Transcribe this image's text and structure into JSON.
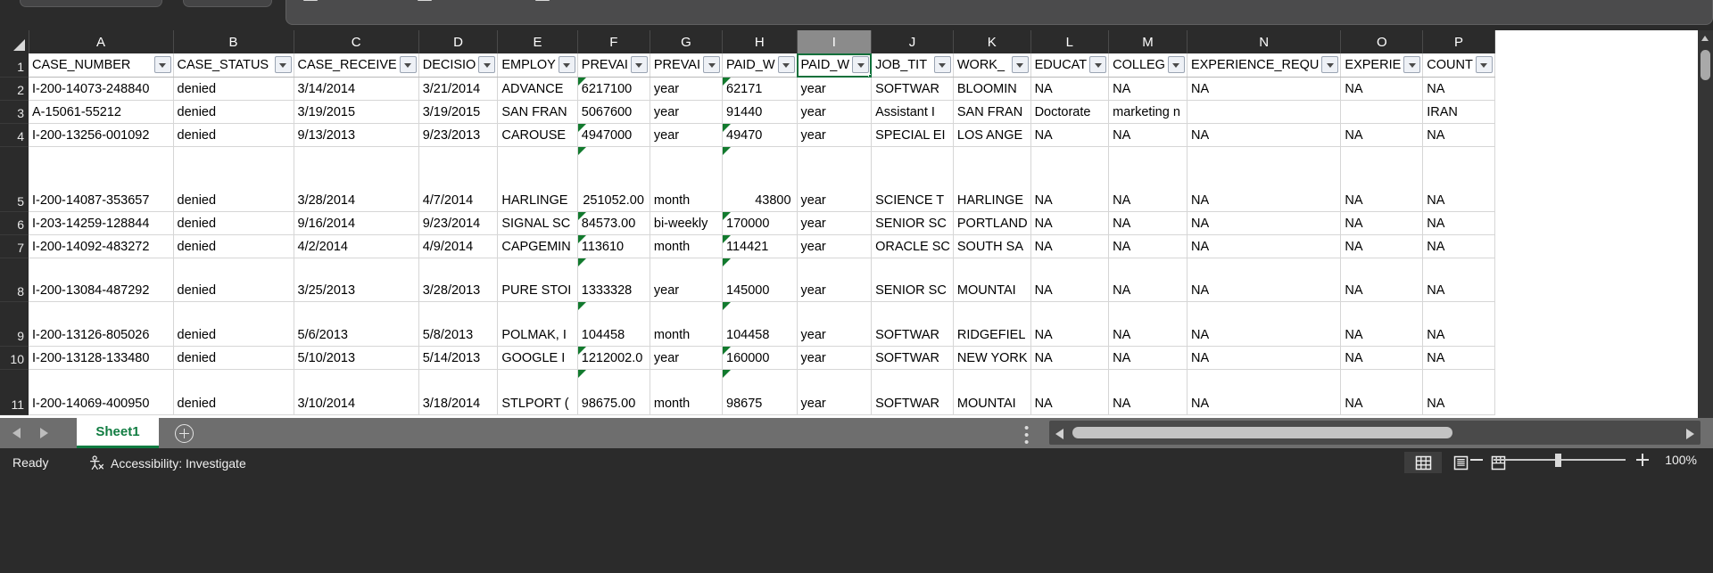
{
  "app": {
    "name": "Microsoft Excel"
  },
  "grid": {
    "corner_label": "select-all",
    "column_letters": [
      "A",
      "B",
      "C",
      "D",
      "E",
      "F",
      "G",
      "H",
      "I",
      "J",
      "K",
      "L",
      "M",
      "N",
      "O",
      "P"
    ],
    "selected_column": "I",
    "selected_cell": "I1",
    "headers": [
      "CASE_NUMBER",
      "CASE_STATUS",
      "CASE_RECEIVE",
      "DECISIO",
      "EMPLOY",
      "PREVAI",
      "PREVAI",
      "PAID_W",
      "PAID_W",
      "JOB_TIT",
      "WORK_",
      "EDUCAT",
      "COLLEG",
      "EXPERIENCE_REQU",
      "EXPERIE",
      "COUNT"
    ],
    "row_numbers": [
      "1",
      "2",
      "3",
      "4",
      "5",
      "6",
      "7",
      "8",
      "9",
      "10",
      "11"
    ],
    "rows": [
      {
        "n": "2",
        "cells": [
          "I-200-14073-248840",
          "denied",
          "3/14/2014",
          "3/21/2014",
          "ADVANCE",
          "6217100",
          "year",
          "62171",
          "year",
          "SOFTWAR",
          "BLOOMIN",
          "NA",
          "NA",
          "NA",
          "NA",
          "NA"
        ]
      },
      {
        "n": "3",
        "cells": [
          "A-15061-55212",
          "denied",
          "3/19/2015",
          "3/19/2015",
          "SAN FRAN",
          "5067600",
          "year",
          "91440",
          "year",
          "Assistant I",
          "SAN FRAN",
          "Doctorate",
          "marketing n",
          "",
          "",
          "IRAN"
        ]
      },
      {
        "n": "4",
        "cells": [
          "I-200-13256-001092",
          "denied",
          "9/13/2013",
          "9/23/2013",
          "CAROUSE",
          "4947000",
          "year",
          "49470",
          "year",
          "SPECIAL EI",
          "LOS ANGE",
          "NA",
          "NA",
          "NA",
          "NA",
          "NA"
        ]
      },
      {
        "n": "5",
        "cells": [
          "I-200-14087-353657",
          "denied",
          "3/28/2014",
          "4/7/2014",
          "HARLINGE",
          "251052.00",
          "month",
          "43800",
          "year",
          "SCIENCE T",
          "HARLINGE",
          "NA",
          "NA",
          "NA",
          "NA",
          "NA"
        ]
      },
      {
        "n": "6",
        "cells": [
          "I-203-14259-128844",
          "denied",
          "9/16/2014",
          "9/23/2014",
          "SIGNAL SC",
          "84573.00",
          "bi-weekly",
          "170000",
          "year",
          "SENIOR SC",
          "PORTLAND",
          "NA",
          "NA",
          "NA",
          "NA",
          "NA"
        ]
      },
      {
        "n": "7",
        "cells": [
          "I-200-14092-483272",
          "denied",
          "4/2/2014",
          "4/9/2014",
          "CAPGEMIN",
          "113610",
          "month",
          "114421",
          "year",
          "ORACLE SC",
          "SOUTH SA",
          "NA",
          "NA",
          "NA",
          "NA",
          "NA"
        ]
      },
      {
        "n": "8",
        "cells": [
          "I-200-13084-487292",
          "denied",
          "3/25/2013",
          "3/28/2013",
          "PURE STOI",
          "1333328",
          "year",
          "145000",
          "year",
          "SENIOR SC",
          "MOUNTAI",
          "NA",
          "NA",
          "NA",
          "NA",
          "NA"
        ]
      },
      {
        "n": "9",
        "cells": [
          "I-200-13126-805026",
          "denied",
          "5/6/2013",
          "5/8/2013",
          "POLMAK, I",
          "104458",
          "month",
          "104458",
          "year",
          "SOFTWAR",
          "RIDGEFIEL",
          "NA",
          "NA",
          "NA",
          "NA",
          "NA"
        ]
      },
      {
        "n": "10",
        "cells": [
          "I-200-13128-133480",
          "denied",
          "5/10/2013",
          "5/14/2013",
          "GOOGLE I",
          "1212002.0",
          "year",
          "160000",
          "year",
          "SOFTWAR",
          "NEW YORK",
          "NA",
          "NA",
          "NA",
          "NA",
          "NA"
        ]
      },
      {
        "n": "11",
        "cells": [
          "I-200-14069-400950",
          "denied",
          "3/10/2014",
          "3/18/2014",
          "STLPORT (",
          "98675.00",
          "month",
          "98675",
          "year",
          "SOFTWAR",
          "MOUNTAI",
          "NA",
          "NA",
          "NA",
          "NA",
          "NA"
        ]
      }
    ]
  },
  "tabbar": {
    "prev_label": "previous-sheet",
    "next_label": "next-sheet",
    "sheet_name": "Sheet1",
    "add_label": "add-sheet"
  },
  "statusbar": {
    "ready": "Ready",
    "accessibility": "Accessibility: Investigate",
    "views": [
      "normal-view",
      "page-layout-view",
      "page-break-preview"
    ],
    "active_view": "normal-view",
    "zoom_out": "zoom-out",
    "zoom_in": "zoom-in",
    "zoom_level": "100%"
  },
  "colors": {
    "excel_green": "#107c41",
    "header_dark": "#2b2b2b",
    "tabbar_grey": "#6e6e6e",
    "flag_green": "#127a2e"
  }
}
